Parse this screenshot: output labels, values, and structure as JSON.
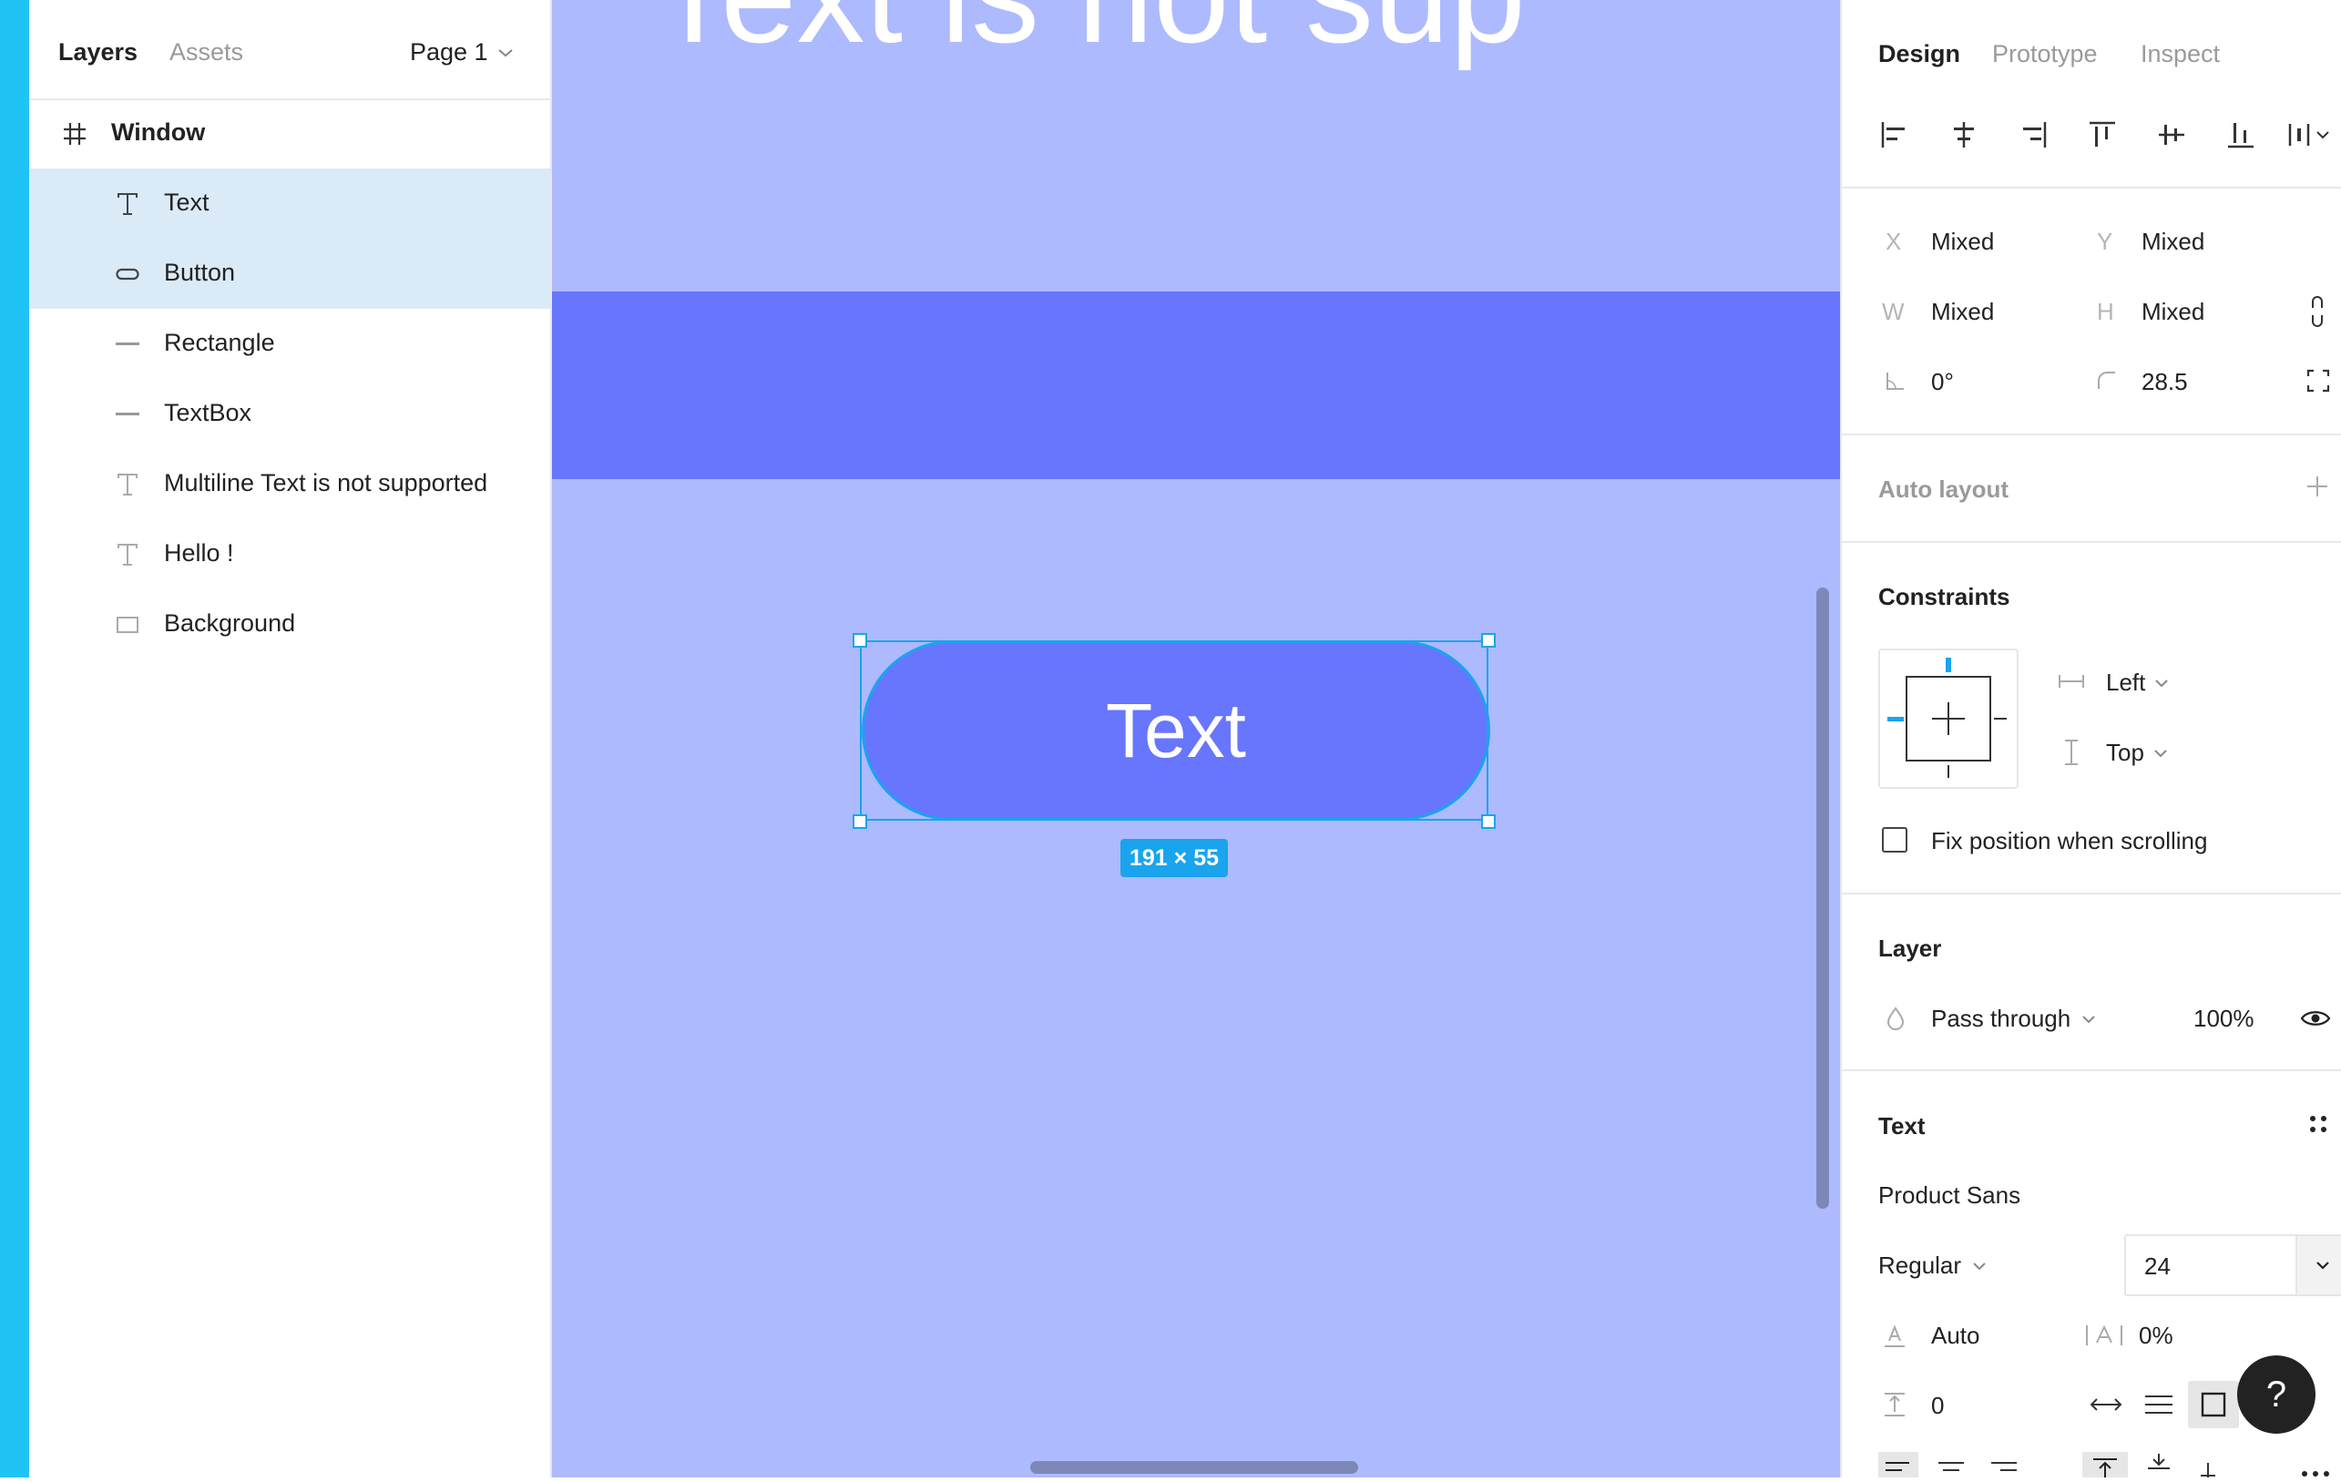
{
  "layers_panel": {
    "tabs": [
      {
        "label": "Layers",
        "active": true
      },
      {
        "label": "Assets",
        "active": false
      }
    ],
    "page_selector": "Page 1",
    "frame": {
      "label": "Window",
      "icon": "frame-hash-icon"
    },
    "items": [
      {
        "label": "Text",
        "icon": "text-icon",
        "selected": true
      },
      {
        "label": "Button",
        "icon": "pill-shape-icon",
        "selected": true
      },
      {
        "label": "Rectangle",
        "icon": "line-icon",
        "selected": false
      },
      {
        "label": "TextBox",
        "icon": "line-icon",
        "selected": false
      },
      {
        "label": "Multiline Text is not supported",
        "icon": "text-icon",
        "selected": false
      },
      {
        "label": "Hello !",
        "icon": "text-icon",
        "selected": false
      },
      {
        "label": "Background",
        "icon": "rectangle-icon",
        "selected": false
      }
    ]
  },
  "canvas": {
    "top_text_fragment": "Text is not sup",
    "button_label": "Text",
    "selection_size": "191 × 55",
    "colors": {
      "background": "#adbafd",
      "band": "#6776fd",
      "button": "#6776fd",
      "selection": "#1aa4ee"
    }
  },
  "design_panel": {
    "tabs": [
      {
        "label": "Design",
        "active": true
      },
      {
        "label": "Prototype",
        "active": false
      },
      {
        "label": "Inspect",
        "active": false
      }
    ],
    "position": {
      "x_label": "X",
      "x_value": "Mixed",
      "y_label": "Y",
      "y_value": "Mixed",
      "w_label": "W",
      "w_value": "Mixed",
      "h_label": "H",
      "h_value": "Mixed",
      "rotation": "0°",
      "corner_radius": "28.5"
    },
    "auto_layout": {
      "title": "Auto layout"
    },
    "constraints": {
      "title": "Constraints",
      "horizontal": "Left",
      "vertical": "Top",
      "fix_position_label": "Fix position when scrolling",
      "fix_position_checked": false
    },
    "layer": {
      "title": "Layer",
      "blend_mode": "Pass through",
      "opacity": "100%"
    },
    "text": {
      "title": "Text",
      "font_family": "Product Sans",
      "font_style": "Regular",
      "font_size": "24",
      "line_height": "Auto",
      "letter_spacing": "0%",
      "paragraph_spacing": "0"
    }
  },
  "help_button": {
    "label": "?"
  }
}
